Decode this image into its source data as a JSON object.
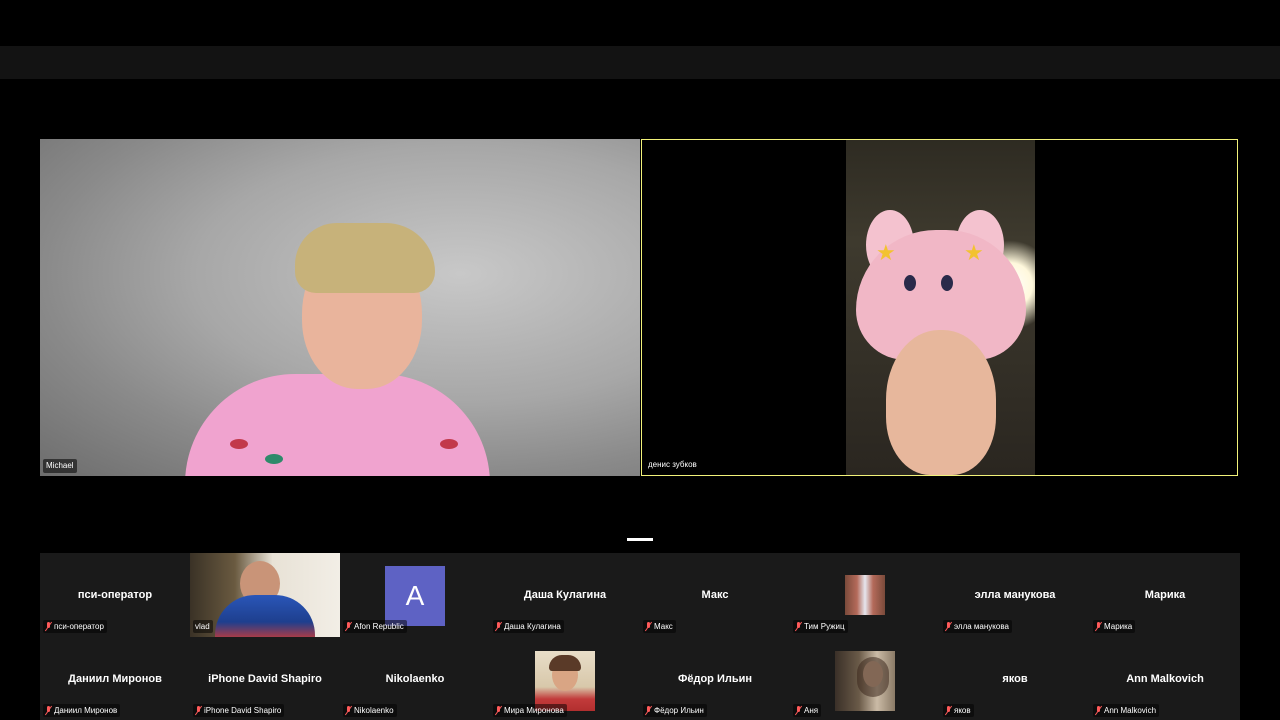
{
  "speakers": [
    {
      "name": "Michael",
      "active": false
    },
    {
      "name": "денис зубков",
      "active": true
    }
  ],
  "gallery": {
    "row1": [
      {
        "display": "пси-оператор",
        "label": "пси-оператор",
        "muted": true,
        "type": "name"
      },
      {
        "display": "",
        "label": "vlad",
        "muted": false,
        "type": "video"
      },
      {
        "display": "A",
        "label": "Afon Republic",
        "muted": true,
        "type": "avatar"
      },
      {
        "display": "Даша Кулагина",
        "label": "Даша Кулагина",
        "muted": true,
        "type": "name"
      },
      {
        "display": "Макс",
        "label": "Макс",
        "muted": true,
        "type": "name"
      },
      {
        "display": "",
        "label": "Тим Ружиц",
        "muted": true,
        "type": "thumb"
      },
      {
        "display": "элла манукова",
        "label": "элла манукова",
        "muted": true,
        "type": "name"
      },
      {
        "display": "Марика",
        "label": "Марика",
        "muted": true,
        "type": "name"
      }
    ],
    "row2": [
      {
        "display": "Даниил Миронов",
        "label": "Даниил Миронов",
        "muted": true,
        "type": "name"
      },
      {
        "display": "iPhone David Shapiro",
        "label": "iPhone David Shapiro",
        "muted": true,
        "type": "name"
      },
      {
        "display": "Nikolaenko",
        "label": "Nikolaenko",
        "muted": true,
        "type": "name"
      },
      {
        "display": "",
        "label": "Мира Миронова",
        "muted": true,
        "type": "thumb"
      },
      {
        "display": "Фёдор Ильин",
        "label": "Фёдор Ильин",
        "muted": true,
        "type": "name"
      },
      {
        "display": "",
        "label": "Аня",
        "muted": true,
        "type": "thumb"
      },
      {
        "display": "яков",
        "label": "яков",
        "muted": true,
        "type": "name"
      },
      {
        "display": "Ann Malkovich",
        "label": "Ann Malkovich",
        "muted": true,
        "type": "name"
      }
    ]
  },
  "colors": {
    "background": "#000000",
    "gallery_bg": "#1a1a1a",
    "active_speaker_border": "#f2f27a",
    "avatar_a": "#5e62c4",
    "muted_icon": "#ff5a5a"
  }
}
